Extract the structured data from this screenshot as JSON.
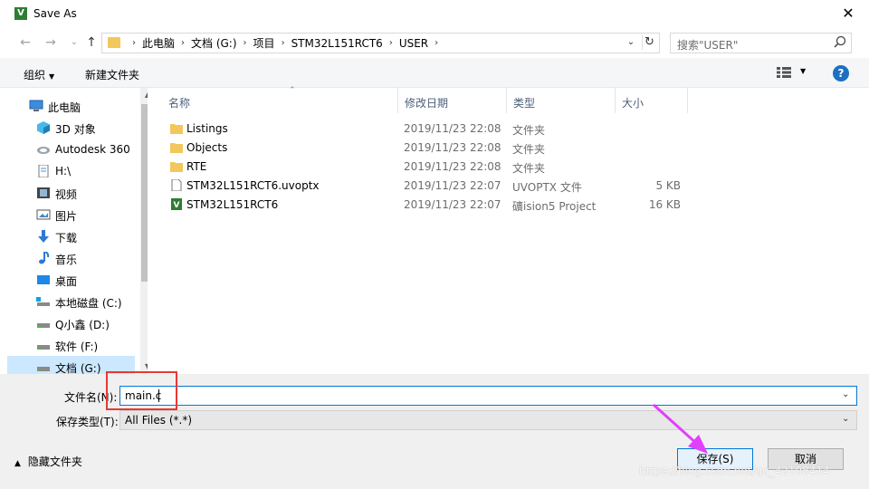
{
  "window": {
    "title": "Save As",
    "app_icon_letter": "V",
    "close_glyph": "✕"
  },
  "nav": {
    "back_glyph": "←",
    "forward_glyph": "→",
    "recent_glyph": "⌄",
    "up_glyph": "↑",
    "breadcrumbs": [
      "此电脑",
      "文档 (G:)",
      "项目",
      "STM32L151RCT6",
      "USER"
    ],
    "separator": "›",
    "search_placeholder": "搜索\"USER\""
  },
  "toolbar": {
    "organize": "组织",
    "new_folder": "新建文件夹",
    "help": "?"
  },
  "sidebar": {
    "items": [
      {
        "label": "此电脑",
        "icon": "computer-icon"
      },
      {
        "label": "3D 对象",
        "icon": "3d-objects-icon"
      },
      {
        "label": "Autodesk 360",
        "icon": "cloud-icon"
      },
      {
        "label": "H:\\",
        "icon": "document-icon"
      },
      {
        "label": "视频",
        "icon": "video-icon"
      },
      {
        "label": "图片",
        "icon": "picture-icon"
      },
      {
        "label": "下载",
        "icon": "download-icon"
      },
      {
        "label": "音乐",
        "icon": "music-icon"
      },
      {
        "label": "桌面",
        "icon": "desktop-icon"
      },
      {
        "label": "本地磁盘 (C:)",
        "icon": "drive-icon"
      },
      {
        "label": "Q小鑫 (D:)",
        "icon": "drive-icon"
      },
      {
        "label": "软件 (F:)",
        "icon": "drive-icon"
      },
      {
        "label": "文档 (G:)",
        "icon": "drive-icon"
      }
    ]
  },
  "files": {
    "columns": [
      "名称",
      "修改日期",
      "类型",
      "大小"
    ],
    "rows": [
      {
        "name": "Listings",
        "date": "2019/11/23 22:08",
        "type": "文件夹",
        "size": "",
        "icon": "folder-icon"
      },
      {
        "name": "Objects",
        "date": "2019/11/23 22:08",
        "type": "文件夹",
        "size": "",
        "icon": "folder-icon"
      },
      {
        "name": "RTE",
        "date": "2019/11/23 22:08",
        "type": "文件夹",
        "size": "",
        "icon": "folder-icon"
      },
      {
        "name": "STM32L151RCT6.uvoptx",
        "date": "2019/11/23 22:07",
        "type": "UVOPTX 文件",
        "size": "5 KB",
        "icon": "file-icon"
      },
      {
        "name": "STM32L151RCT6",
        "date": "2019/11/23 22:07",
        "type": "礦ision5 Project",
        "size": "16 KB",
        "icon": "keil-project-icon"
      }
    ]
  },
  "form": {
    "filename_label": "文件名(N):",
    "filename_value": "main.c",
    "filetype_label": "保存类型(T):",
    "filetype_value": "All Files (*.*)"
  },
  "footer": {
    "hide_folders": "隐藏文件夹",
    "save_button": "保存(S)",
    "cancel_button": "取消",
    "watermark": "https://blog.csdn.net/qq_42108414"
  },
  "colors": {
    "accent": "#0078d7",
    "highlight_box": "#e53935",
    "arrow": "#e040fb",
    "selection": "#cce8ff",
    "folder": "#f2c75c"
  }
}
